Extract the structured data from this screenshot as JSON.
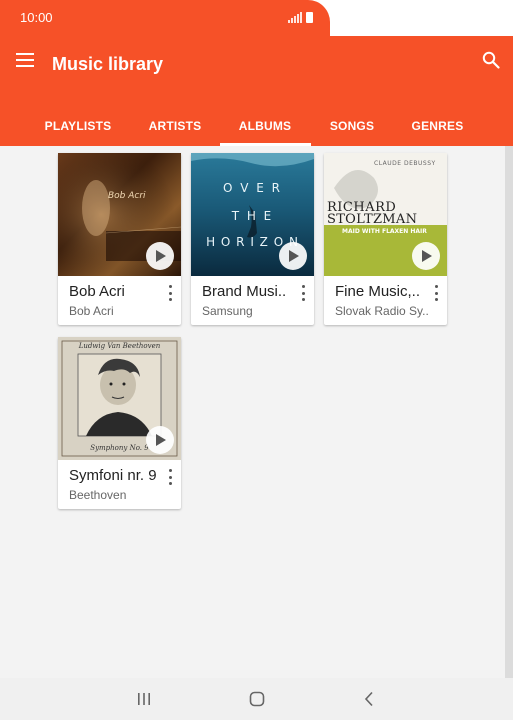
{
  "status": {
    "time": "10:00"
  },
  "header": {
    "title": "Music library"
  },
  "tabs": [
    {
      "label": "PLAYLISTS"
    },
    {
      "label": "ARTISTS"
    },
    {
      "label": "ALBUMS"
    },
    {
      "label": "SONGS"
    },
    {
      "label": "GENRES"
    }
  ],
  "active_tab": "ALBUMS",
  "albums": [
    {
      "title": "Bob Acri",
      "artist": "Bob Acri",
      "art_text": "Bob Acri"
    },
    {
      "title": "Brand Musi..",
      "artist": "Samsung",
      "art_lines": [
        "O V E R",
        "T H E",
        "H O R I Z O N"
      ]
    },
    {
      "title": "Fine Music,..",
      "artist": "Slovak Radio Sy..",
      "art_top": "CLAUDE DEBUSSY",
      "art_name1": "RICHARD",
      "art_name2": "STOLTZMAN",
      "art_sub": "MAID WITH FLAXEN HAIR"
    },
    {
      "title": "Symfoni nr. 9",
      "artist": "Beethoven",
      "art_top": "Ludwig Van Beethoven",
      "art_bottom": "Symphony No. 9"
    }
  ],
  "colors": {
    "accent": "#f65128",
    "background": "#f3f3f3"
  }
}
